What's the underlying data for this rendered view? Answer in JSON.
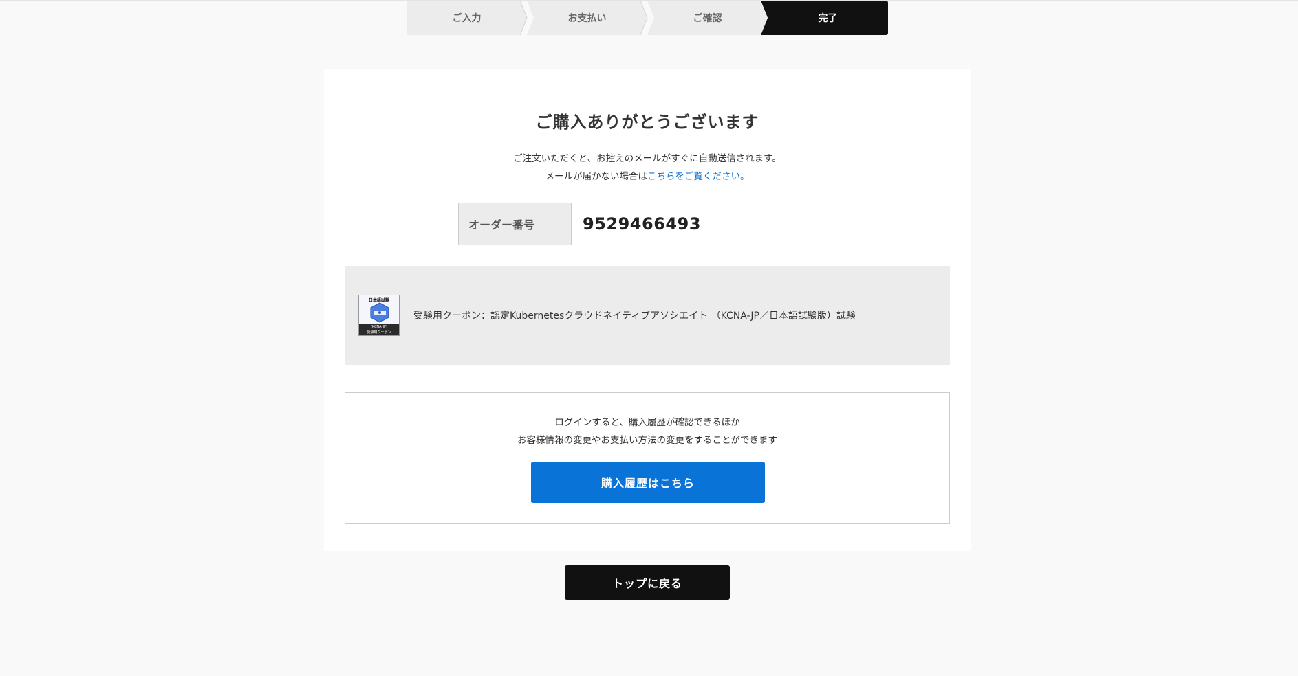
{
  "stepper": {
    "steps": [
      {
        "label": "ご入力"
      },
      {
        "label": "お支払い"
      },
      {
        "label": "ご確認"
      },
      {
        "label": "完了"
      }
    ]
  },
  "confirmation": {
    "title": "ご購入ありがとうございます",
    "message_line1": "ご注文いただくと、お控えのメールがすぐに自動送信されます。",
    "message_line2_prefix": "メールが届かない場合は",
    "message_link": "こちらをご覧ください。"
  },
  "order": {
    "label": "オーダー番号",
    "number": "9529466493"
  },
  "product": {
    "name": "受験用クーポン：認定Kubernetesクラウドネイティブアソシエイト （KCNA-JP／日本語試験版）試験",
    "thumb_header": "日本語試験",
    "thumb_footer_line1": "(KCNA-JP)",
    "thumb_footer_line2": "受験用クーポン"
  },
  "login_prompt": {
    "line1": "ログインすると、購入履歴が確認できるほか",
    "line2": "お客様情報の変更やお支払い方法の変更をすることができます",
    "button_label": "購入履歴はこちら"
  },
  "footer": {
    "back_to_top_label": "トップに戻る"
  },
  "colors": {
    "accent_blue": "#0a73d7",
    "dark": "#111111",
    "panel_gray": "#ececec"
  }
}
